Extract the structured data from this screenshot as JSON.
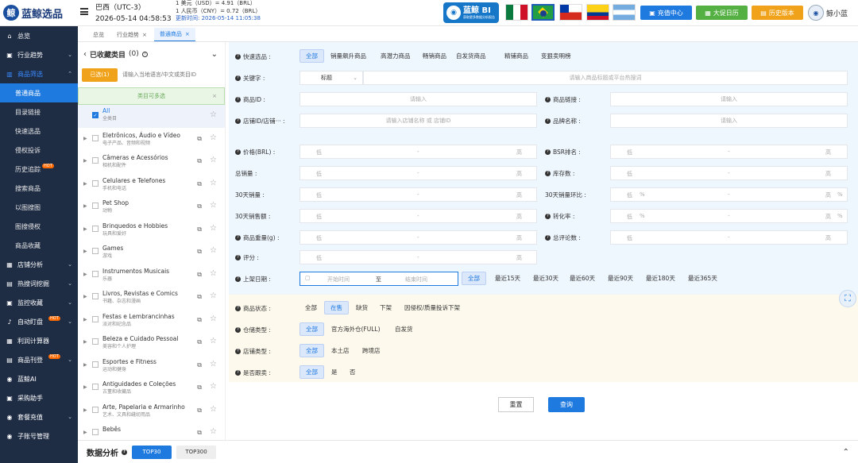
{
  "brand": {
    "name": "蓝鲸选品",
    "logo_glyph": "鲸"
  },
  "region": {
    "country": "巴西（UTC-3）",
    "time": "2026-05-14 04:58:53"
  },
  "rates": {
    "line1": "1 美元（USD）=      4.91（BRL）",
    "line2": "1 人民币（CNY）=   0.72（BRL）",
    "updated": "更新时间: 2026-05-14 11:05:38"
  },
  "bi": {
    "title": "蓝鲸 BI",
    "sub": "获取更多数据分析报告"
  },
  "top_buttons": {
    "charge": "充值中心",
    "promo": "大促日历",
    "history": "历史版本"
  },
  "user": {
    "name": "鲸小蓝"
  },
  "nav": {
    "home": "总览",
    "trend": "行业趋势",
    "product": "商品筛选",
    "sub": [
      "普通商品",
      "目录链接",
      "快速选品",
      "侵权投诉",
      "历史追踪",
      "搜索商品",
      "以图搜图",
      "图搜侵权",
      "商品收藏"
    ],
    "shop": "店铺分析",
    "keyword": "热搜词挖掘",
    "monitor": "监控收藏",
    "auto": "自动盯盘",
    "profit": "利润计算器",
    "upload": "商品刊登",
    "ai": "蓝鲸AI",
    "purchase": "采购助手",
    "vip": "套餐充值",
    "account": "子账号管理",
    "hot_badge": "HOT"
  },
  "tabs": [
    "总览",
    "行业趋势",
    "普通商品"
  ],
  "catpanel": {
    "title": "已收藏类目",
    "count": "(0)",
    "selected_btn": "已选(1)",
    "search_placeholder": "请输入当地语言/中文或类目ID",
    "multi_tip": "类目可多选",
    "items": [
      {
        "en": "All",
        "zh": "全类目"
      },
      {
        "en": "Eletrônicos, Áudio e Vídeo",
        "zh": "电子产品、音频和视频"
      },
      {
        "en": "Câmeras e Acessórios",
        "zh": "相机和配件"
      },
      {
        "en": "Celulares e Telefones",
        "zh": "手机和电话"
      },
      {
        "en": "Pet Shop",
        "zh": "动物"
      },
      {
        "en": "Brinquedos e Hobbies",
        "zh": "玩具和爱好"
      },
      {
        "en": "Games",
        "zh": "游戏"
      },
      {
        "en": "Instrumentos Musicais",
        "zh": "乐器"
      },
      {
        "en": "Livros, Revistas e Comics",
        "zh": "书籍、杂志和漫画"
      },
      {
        "en": "Festas e Lembrancinhas",
        "zh": "派对和纪念品"
      },
      {
        "en": "Beleza e Cuidado Pessoal",
        "zh": "美容和个人护理"
      },
      {
        "en": "Esportes e Fitness",
        "zh": "运动和健身"
      },
      {
        "en": "Antiguidades e Coleções",
        "zh": "古董和收藏品"
      },
      {
        "en": "Arte, Papelaria e Armarinho",
        "zh": "艺术、文具和缝纫用品"
      },
      {
        "en": "Bebês",
        "zh": ""
      }
    ]
  },
  "filter": {
    "quick": {
      "label": "快速选品 :",
      "chips": [
        "全部",
        "销量飙升商品",
        "高潜力商品",
        "畅销商品",
        "自发货商品",
        "精铺商品",
        "变狠卖明榜"
      ]
    },
    "keyword": {
      "label": "关键字 :",
      "select": "标题",
      "placeholder": "请输入商品标题或平台热搜词"
    },
    "product_id": {
      "label": "商品ID :",
      "placeholder": "请输入"
    },
    "product_link": {
      "label": "商品链接 :",
      "placeholder": "请输入"
    },
    "shop_id": {
      "label": "店铺ID/店铺··· :",
      "placeholder": "请输入店铺名称 或 店铺ID"
    },
    "brand_name": {
      "label": "品牌名称 :",
      "placeholder": "请输入"
    },
    "range_low": "低",
    "range_high": "高",
    "range_dash": "-",
    "pct": "%",
    "price": "价格(BRL) :",
    "bsr": "BSR排名 :",
    "total_sales": "总销量 :",
    "stock": "库存数 :",
    "sales30": "30天销量 :",
    "ratio30": "30天销量环比 :",
    "amount30": "30天销售额 :",
    "conversion": "转化率 :",
    "weight": "商品重量(g) :",
    "reviews": "总评论数 :",
    "rating": "评分 :",
    "listing": {
      "label": "上架日期 :",
      "start": "开始时间",
      "to": "至",
      "end": "结束时间",
      "all": "全部",
      "opts": [
        "最近15天",
        "最近30天",
        "最近60天",
        "最近90天",
        "最近180天",
        "最近365天"
      ]
    },
    "status": {
      "label": "商品状态 :",
      "opts": [
        "全部",
        "在售",
        "缺货",
        "下架",
        "因侵权/质量投诉下架"
      ]
    },
    "warehouse": {
      "label": "仓储类型 :",
      "opts": [
        "全部",
        "官方海外仓(FULL)",
        "自发货"
      ]
    },
    "shoptype": {
      "label": "店铺类型 :",
      "opts": [
        "全部",
        "本土店",
        "跨境店"
      ]
    },
    "follow": {
      "label": "是否跟卖 :",
      "opts": [
        "全部",
        "是",
        "否"
      ]
    }
  },
  "actions": {
    "reset": "重置",
    "query": "查询"
  },
  "analysis": {
    "title": "数据分析",
    "top30": "TOP30",
    "top300": "TOP300"
  }
}
